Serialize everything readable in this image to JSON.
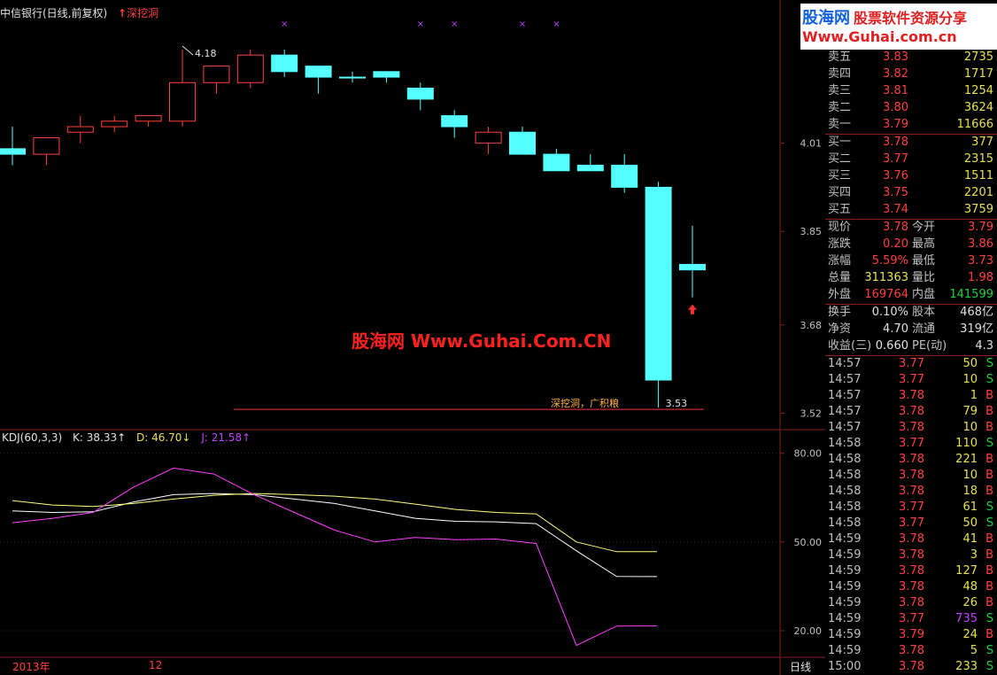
{
  "title": {
    "stock": "中信银行(日线,前复权)",
    "indicator": "深挖洞",
    "indicator_arrow": "↑"
  },
  "kdj_header": {
    "name": "KDJ(60,3,3)",
    "k": "K: 38.33↑",
    "d": "D: 46.70↓",
    "j": "J: 21.58↑"
  },
  "watermark": "股海网 Www.Guhai.Com.CN",
  "logo": {
    "brand": "股海网",
    "slogan": "股票软件资源分享",
    "url": "Www.Guhai.com.cn"
  },
  "bottom": {
    "year": "2013年",
    "month": "12",
    "period": "日线"
  },
  "chart_data": [
    {
      "type": "candlestick",
      "title": "中信银行(日线,前复权)",
      "y_ticks": [
        4.01,
        3.85,
        3.68,
        3.52
      ],
      "y_tick_labels": [
        "4.01",
        "3.85",
        "3.68",
        "3.52"
      ],
      "ylim": [
        3.49,
        4.27
      ],
      "candles": [
        {
          "o": 4.0,
          "h": 4.04,
          "l": 3.97,
          "c": 3.99
        },
        {
          "o": 3.99,
          "h": 4.02,
          "l": 3.97,
          "c": 4.02
        },
        {
          "o": 4.03,
          "h": 4.06,
          "l": 4.01,
          "c": 4.04
        },
        {
          "o": 4.04,
          "h": 4.06,
          "l": 4.03,
          "c": 4.05
        },
        {
          "o": 4.05,
          "h": 4.06,
          "l": 4.04,
          "c": 4.06
        },
        {
          "o": 4.05,
          "h": 4.18,
          "l": 4.04,
          "c": 4.12
        },
        {
          "o": 4.12,
          "h": 4.15,
          "l": 4.1,
          "c": 4.15
        },
        {
          "o": 4.12,
          "h": 4.18,
          "l": 4.11,
          "c": 4.17
        },
        {
          "o": 4.17,
          "h": 4.18,
          "l": 4.13,
          "c": 4.14
        },
        {
          "o": 4.15,
          "h": 4.15,
          "l": 4.1,
          "c": 4.13
        },
        {
          "o": 4.13,
          "h": 4.14,
          "l": 4.12,
          "c": 4.13
        },
        {
          "o": 4.14,
          "h": 4.14,
          "l": 4.12,
          "c": 4.13
        },
        {
          "o": 4.11,
          "h": 4.12,
          "l": 4.07,
          "c": 4.09
        },
        {
          "o": 4.06,
          "h": 4.07,
          "l": 4.02,
          "c": 4.04
        },
        {
          "o": 4.01,
          "h": 4.04,
          "l": 3.99,
          "c": 4.03
        },
        {
          "o": 4.03,
          "h": 4.04,
          "l": 3.99,
          "c": 3.99
        },
        {
          "o": 3.99,
          "h": 4.0,
          "l": 3.97,
          "c": 3.96
        },
        {
          "o": 3.97,
          "h": 3.99,
          "l": 3.96,
          "c": 3.96
        },
        {
          "o": 3.97,
          "h": 3.99,
          "l": 3.92,
          "c": 3.93
        },
        {
          "o": 3.93,
          "h": 3.94,
          "l": 3.53,
          "c": 3.58
        },
        {
          "o": 3.79,
          "h": 3.86,
          "l": 3.73,
          "c": 3.78
        }
      ],
      "x_marks": [
        8,
        12,
        13,
        15,
        16
      ],
      "annotations": [
        {
          "text": "4.18",
          "candle": 5
        },
        {
          "text": "深挖洞，广积粮",
          "candle": 16
        },
        {
          "text": "3.53",
          "candle": 19
        }
      ],
      "signal_line": 3.53,
      "signal_arrow_candle": 20
    },
    {
      "type": "line",
      "title": "KDJ(60,3,3)",
      "y_ticks": [
        80,
        50,
        20
      ],
      "y_tick_labels": [
        "80.00",
        "50.00",
        "20.00"
      ],
      "ylim": [
        11,
        88
      ],
      "series": [
        {
          "name": "K",
          "color": "#ffffff",
          "values": [
            60.5,
            60.0,
            60.2,
            63.5,
            66.0,
            66.4,
            66.0,
            64.5,
            63.0,
            60.5,
            58.0,
            57.0,
            56.8,
            56.2,
            47.0,
            38.33,
            38.3
          ]
        },
        {
          "name": "D",
          "color": "#ffff80",
          "values": [
            64.0,
            62.5,
            62.0,
            63.0,
            64.5,
            65.8,
            66.4,
            66.0,
            65.5,
            64.5,
            62.8,
            61.0,
            60.0,
            59.5,
            50.0,
            46.7,
            46.7
          ]
        },
        {
          "name": "J",
          "color": "#ff40ff",
          "values": [
            56.5,
            58.0,
            60.0,
            68.5,
            75.0,
            73.0,
            66.0,
            60.0,
            54.0,
            50.0,
            51.5,
            50.8,
            51.0,
            49.5,
            15.0,
            21.58,
            21.6
          ]
        }
      ]
    }
  ],
  "quote": {
    "asks": [
      {
        "label": "卖五",
        "price": "3.83",
        "vol": "2735"
      },
      {
        "label": "卖四",
        "price": "3.82",
        "vol": "1717"
      },
      {
        "label": "卖三",
        "price": "3.81",
        "vol": "1254"
      },
      {
        "label": "卖二",
        "price": "3.80",
        "vol": "3624"
      },
      {
        "label": "卖一",
        "price": "3.79",
        "vol": "11666"
      }
    ],
    "bids": [
      {
        "label": "买一",
        "price": "3.78",
        "vol": "377"
      },
      {
        "label": "买二",
        "price": "3.77",
        "vol": "2315"
      },
      {
        "label": "买三",
        "price": "3.76",
        "vol": "1511"
      },
      {
        "label": "买四",
        "price": "3.75",
        "vol": "2201"
      },
      {
        "label": "买五",
        "price": "3.74",
        "vol": "3759"
      }
    ],
    "stats": [
      {
        "l1": "现价",
        "v1": "3.78",
        "l2": "今开",
        "v2": "3.79",
        "c1": "red",
        "c2": "red"
      },
      {
        "l1": "涨跌",
        "v1": "0.20",
        "l2": "最高",
        "v2": "3.86",
        "c1": "red",
        "c2": "red"
      },
      {
        "l1": "涨幅",
        "v1": "5.59%",
        "l2": "最低",
        "v2": "3.73",
        "c1": "red",
        "c2": "red"
      },
      {
        "l1": "总量",
        "v1": "311363",
        "l2": "量比",
        "v2": "1.98",
        "c1": "yellow",
        "c2": "red"
      },
      {
        "l1": "外盘",
        "v1": "169764",
        "l2": "内盘",
        "v2": "141599",
        "c1": "red",
        "c2": "green"
      }
    ],
    "fund": [
      {
        "l1": "换手",
        "v1": "0.10%",
        "l2": "股本",
        "v2": "468亿"
      },
      {
        "l1": "净资",
        "v1": "4.70",
        "l2": "流通",
        "v2": "319亿"
      },
      {
        "l1": "收益(三)",
        "v1": "0.660",
        "l2": "PE(动)",
        "v2": "4.3"
      }
    ],
    "ticks": [
      {
        "t": "14:57",
        "p": "3.77",
        "v": "50",
        "s": "S"
      },
      {
        "t": "14:57",
        "p": "3.77",
        "v": "10",
        "s": "S"
      },
      {
        "t": "14:57",
        "p": "3.78",
        "v": "1",
        "s": "B"
      },
      {
        "t": "14:57",
        "p": "3.78",
        "v": "79",
        "s": "B"
      },
      {
        "t": "14:57",
        "p": "3.78",
        "v": "10",
        "s": "B"
      },
      {
        "t": "14:58",
        "p": "3.77",
        "v": "110",
        "s": "S"
      },
      {
        "t": "14:58",
        "p": "3.78",
        "v": "221",
        "s": "B"
      },
      {
        "t": "14:58",
        "p": "3.78",
        "v": "10",
        "s": "B"
      },
      {
        "t": "14:58",
        "p": "3.78",
        "v": "18",
        "s": "B"
      },
      {
        "t": "14:58",
        "p": "3.77",
        "v": "61",
        "s": "S"
      },
      {
        "t": "14:58",
        "p": "3.77",
        "v": "50",
        "s": "S"
      },
      {
        "t": "14:59",
        "p": "3.78",
        "v": "41",
        "s": "B"
      },
      {
        "t": "14:59",
        "p": "3.78",
        "v": "3",
        "s": "B"
      },
      {
        "t": "14:59",
        "p": "3.78",
        "v": "127",
        "s": "B"
      },
      {
        "t": "14:59",
        "p": "3.78",
        "v": "48",
        "s": "B"
      },
      {
        "t": "14:59",
        "p": "3.78",
        "v": "26",
        "s": "B"
      },
      {
        "t": "14:59",
        "p": "3.77",
        "v": "735",
        "s": "S",
        "big": true
      },
      {
        "t": "14:59",
        "p": "3.79",
        "v": "24",
        "s": "B"
      },
      {
        "t": "14:59",
        "p": "3.78",
        "v": "5",
        "s": "S"
      },
      {
        "t": "15:00",
        "p": "3.78",
        "v": "233",
        "s": "S"
      }
    ]
  },
  "colors": {
    "up": "#ff4040",
    "down": "#54ffff",
    "grid_red": "#8a1c1c",
    "background": "#000000"
  }
}
